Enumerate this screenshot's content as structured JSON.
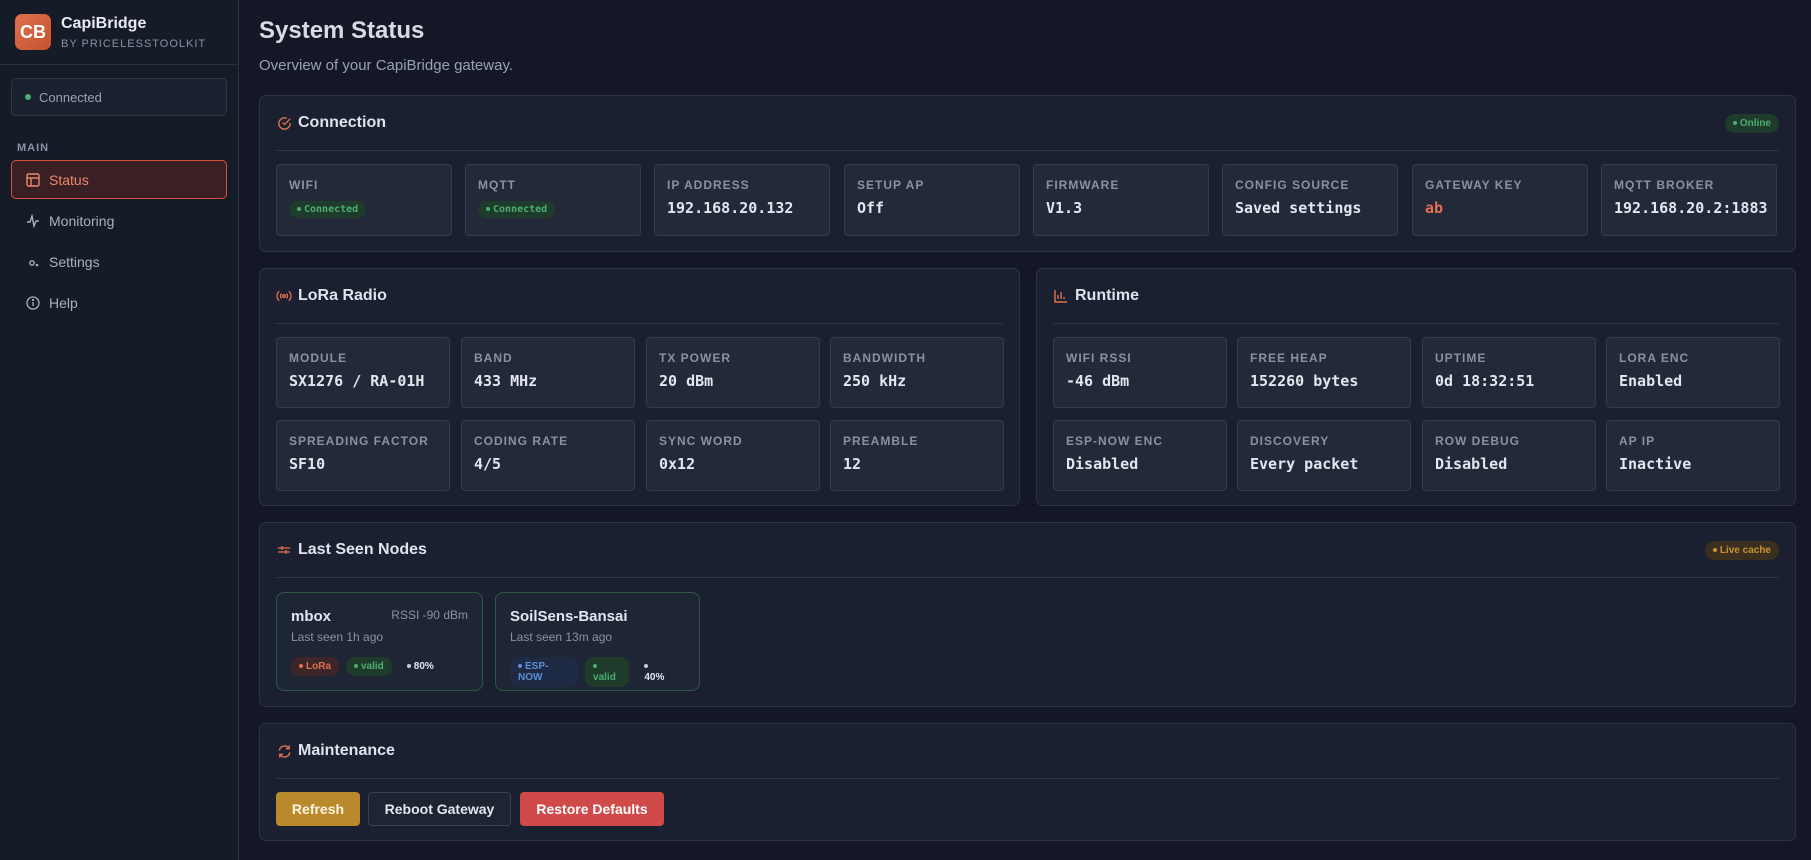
{
  "brand": {
    "logo": "CB",
    "name": "CapiBridge",
    "subtitle": "BY PRICELESSTOOLKIT"
  },
  "sidebar": {
    "connection_status": "Connected",
    "section_label": "MAIN",
    "items": [
      {
        "label": "Status",
        "icon": "layout-icon",
        "active": true
      },
      {
        "label": "Monitoring",
        "icon": "activity-icon",
        "active": false
      },
      {
        "label": "Settings",
        "icon": "gear-icon",
        "active": false
      },
      {
        "label": "Help",
        "icon": "info-icon",
        "active": false
      }
    ]
  },
  "header": {
    "title": "System Status",
    "subtitle": "Overview of your CapiBridge gateway."
  },
  "connection": {
    "title": "Connection",
    "badge": "Online",
    "tiles": [
      {
        "label": "WIFI",
        "value": "Connected",
        "type": "badge"
      },
      {
        "label": "MQTT",
        "value": "Connected",
        "type": "badge"
      },
      {
        "label": "IP ADDRESS",
        "value": "192.168.20.132"
      },
      {
        "label": "SETUP AP",
        "value": "Off"
      },
      {
        "label": "FIRMWARE",
        "value": "V1.3"
      },
      {
        "label": "CONFIG SOURCE",
        "value": "Saved settings"
      },
      {
        "label": "GATEWAY KEY",
        "value": "ab",
        "accent": true
      },
      {
        "label": "MQTT BROKER",
        "value": "192.168.20.2:1883"
      }
    ]
  },
  "lora": {
    "title": "LoRa Radio",
    "tiles": [
      {
        "label": "MODULE",
        "value": "SX1276 / RA-01H"
      },
      {
        "label": "BAND",
        "value": "433 MHz"
      },
      {
        "label": "TX POWER",
        "value": "20 dBm"
      },
      {
        "label": "BANDWIDTH",
        "value": "250 kHz"
      },
      {
        "label": "SPREADING FACTOR",
        "value": "SF10"
      },
      {
        "label": "CODING RATE",
        "value": "4/5"
      },
      {
        "label": "SYNC WORD",
        "value": "0x12"
      },
      {
        "label": "PREAMBLE",
        "value": "12"
      }
    ]
  },
  "runtime": {
    "title": "Runtime",
    "tiles": [
      {
        "label": "WIFI RSSI",
        "value": "-46 dBm"
      },
      {
        "label": "FREE HEAP",
        "value": "152260 bytes"
      },
      {
        "label": "UPTIME",
        "value": "0d 18:32:51"
      },
      {
        "label": "LORA ENC",
        "value": "Enabled"
      },
      {
        "label": "ESP-NOW ENC",
        "value": "Disabled"
      },
      {
        "label": "DISCOVERY",
        "value": "Every packet"
      },
      {
        "label": "ROW DEBUG",
        "value": "Disabled"
      },
      {
        "label": "AP IP",
        "value": "Inactive"
      }
    ]
  },
  "nodes": {
    "title": "Last Seen Nodes",
    "badge": "Live cache",
    "items": [
      {
        "name": "mbox",
        "seen": "Last seen 1h ago",
        "rssi": "RSSI -90 dBm",
        "proto": "LoRa",
        "state": "valid",
        "battery": "80%"
      },
      {
        "name": "SoilSens-Bansai",
        "seen": "Last seen 13m ago",
        "rssi": "",
        "proto": "ESP-NOW",
        "state": "valid",
        "battery": "40%"
      }
    ]
  },
  "maintenance": {
    "title": "Maintenance",
    "buttons": {
      "refresh": "Refresh",
      "reboot": "Reboot Gateway",
      "restore": "Restore Defaults"
    }
  },
  "colors": {
    "accent": "#e0714f",
    "success": "#4caf70",
    "warning": "#c9912f",
    "danger": "#d14a4a",
    "info": "#5b8fd6"
  }
}
